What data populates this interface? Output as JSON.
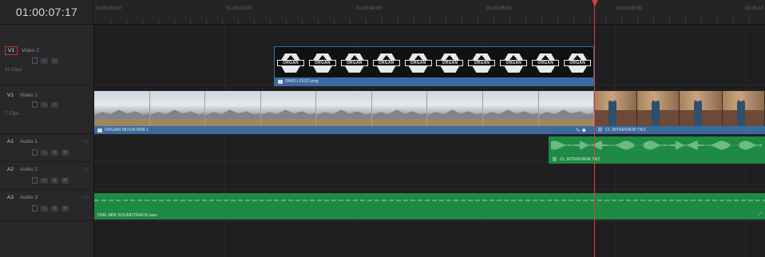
{
  "timecode": "01:00:07:17",
  "ruler": {
    "labels": [
      "01:00:00:00",
      "01:00:02:00",
      "01:00:04:00",
      "01:00:06:00",
      "01:00:08:00",
      "01:00:10"
    ]
  },
  "tracks": {
    "v2": {
      "id": "V1",
      "name": "Video 2",
      "count": "10 Clips"
    },
    "v1": {
      "id": "V1",
      "name": "Video 1",
      "count": "7 Clips"
    },
    "a1": {
      "id": "A1",
      "name": "Audio 1",
      "db": "2.0"
    },
    "a2": {
      "id": "A2",
      "name": "Audio 2",
      "db": "2.0"
    },
    "a3": {
      "id": "A3",
      "name": "Audio 3",
      "db": "2.0"
    }
  },
  "clips": {
    "logo": {
      "name": "OMO-LOGO.png",
      "logo_text": "ORGAN"
    },
    "mountain": {
      "name": "ORGAN MOUNTAIN 1"
    },
    "interview_video": {
      "name": "CL INTERVIEW TK2"
    },
    "interview_audio": {
      "name": "CL INTERVIEW TK2"
    },
    "soundtrack": {
      "name": "ONE MIN SOUNDTRACK.wav"
    }
  },
  "controls": {
    "solo": "S",
    "mute": "M"
  },
  "colors": {
    "video_clip": "#3a6b9e",
    "audio_clip": "#1e8a45",
    "playhead": "#e03a3a"
  },
  "icons": [
    "lock-icon",
    "link-icon",
    "image-icon",
    "video-icon",
    "playhead-icon",
    "transition-icon"
  ]
}
